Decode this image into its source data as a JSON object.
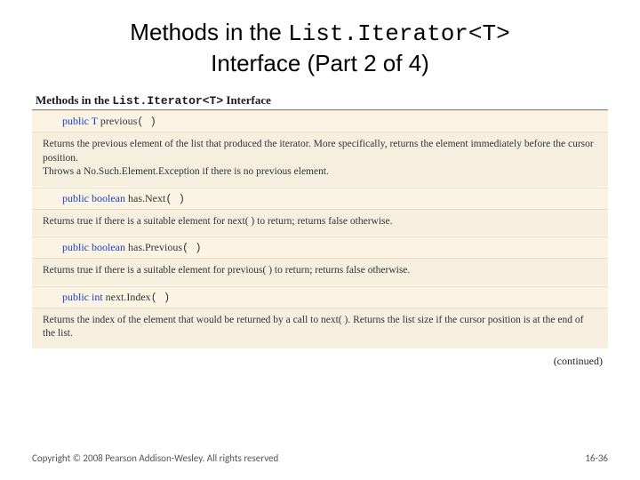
{
  "title": {
    "pre": "Methods in the ",
    "mono": "List.Iterator<T>",
    "post": " Interface (Part 2 of 4)"
  },
  "subhead": {
    "pre": "Methods in the ",
    "mono": "List.Iterator<T>",
    "post": " Interface"
  },
  "m1": {
    "kw": "public",
    "rt": "T",
    "nm": "previous",
    "paren": "( )",
    "d1": "Returns the previous element of the list that produced the iterator. More specifically, returns the element immediately before the cursor position.",
    "d2a": "Throws a ",
    "d2m": "No.Such.Element.Exception",
    "d2b": " if there is no previous element."
  },
  "m2": {
    "kw": "public",
    "rt": "boolean",
    "nm": "has.Next",
    "paren": "( )",
    "d1a": "Returns ",
    "d1m1": "true",
    "d1b": " if there is a suitable element for ",
    "d1m2": "next( )",
    "d1c": " to return; returns ",
    "d1m3": "false",
    "d1d": " otherwise."
  },
  "m3": {
    "kw": "public",
    "rt": "boolean",
    "nm": "has.Previous",
    "paren": "( )",
    "d1a": "Returns ",
    "d1m1": "true",
    "d1b": " if there is a suitable element for ",
    "d1m2": "previous( )",
    "d1c": " to return; returns ",
    "d1m3": "false",
    "d1d": " otherwise."
  },
  "m4": {
    "kw": "public",
    "rt": "int",
    "nm": "next.Index",
    "paren": "( )",
    "d1a": "Returns the index of the element that would be returned by a call to ",
    "d1m1": "next( )",
    "d1b": ". Returns the list size if the cursor position is at the end of the list."
  },
  "cont": "(continued)",
  "footer": {
    "left": "Copyright © 2008 Pearson Addison-Wesley. All rights reserved",
    "right": "16-36"
  }
}
